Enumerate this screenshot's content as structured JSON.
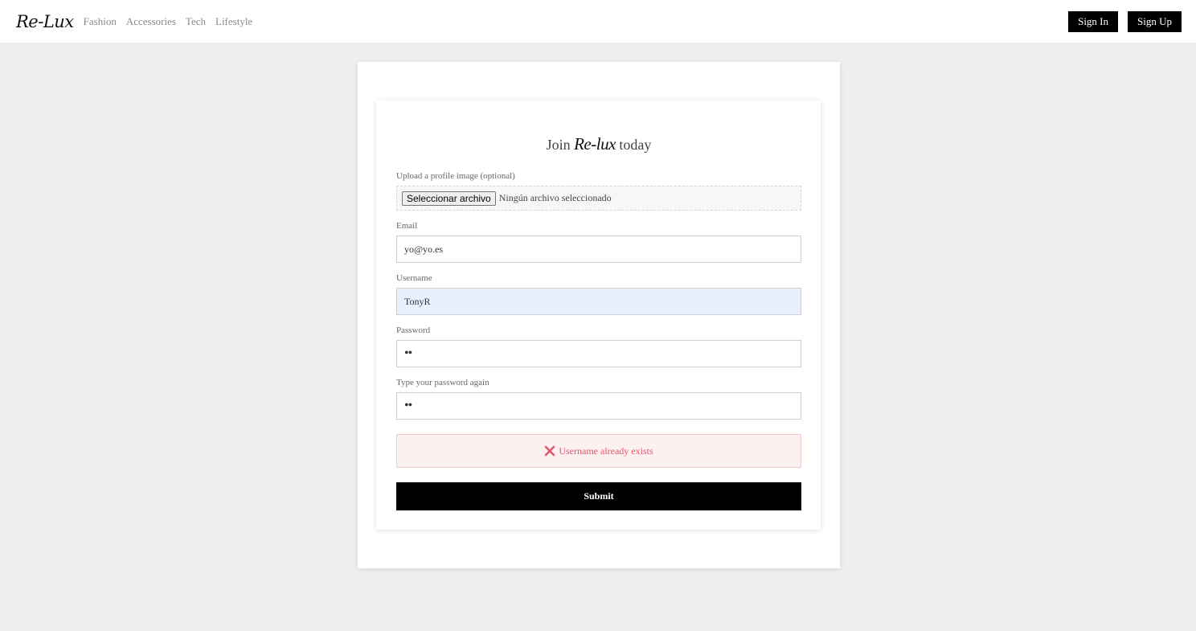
{
  "navbar": {
    "brand": "Re-Lux",
    "links": [
      "Fashion",
      "Accessories",
      "Tech",
      "Lifestyle"
    ],
    "sign_in_label": "Sign In",
    "sign_up_label": "Sign Up"
  },
  "form": {
    "title_prefix": "Join",
    "title_brand": "Re-lux",
    "title_suffix": "today",
    "upload_label": "Upload a profile image (optional)",
    "file_button_label": "Seleccionar archivo",
    "file_status": "Ningún archivo seleccionado",
    "email_label": "Email",
    "email_value": "yo@yo.es",
    "username_label": "Username",
    "username_value": "TonyR",
    "password_label": "Password",
    "password_value": "••",
    "password_confirm_label": "Type your password again",
    "password_confirm_value": "••",
    "error_message": "Username already exists",
    "submit_label": "Submit"
  },
  "colors": {
    "error_text": "#e0576c",
    "error_bg": "#fdf0f0",
    "autofill_bg": "#e8f0fe",
    "button_bg": "#000000"
  },
  "icons": {
    "error": "close-icon"
  }
}
